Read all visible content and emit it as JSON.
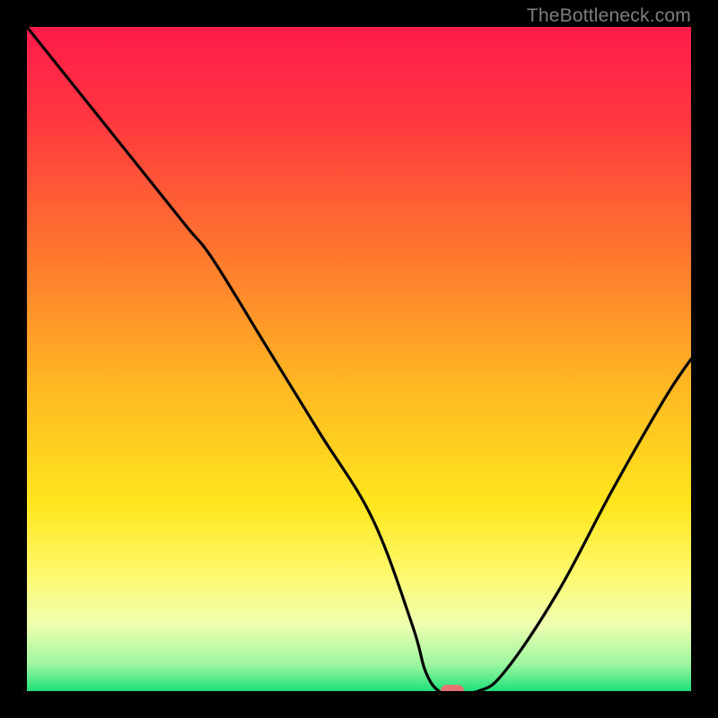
{
  "attribution": "TheBottleneck.com",
  "chart_data": {
    "type": "line",
    "title": "",
    "xlabel": "",
    "ylabel": "",
    "xlim": [
      0,
      100
    ],
    "ylim": [
      0,
      100
    ],
    "x": [
      0,
      8,
      16,
      24,
      28,
      36,
      44,
      52,
      58,
      60,
      62,
      64,
      68,
      72,
      80,
      88,
      96,
      100
    ],
    "y": [
      100,
      90,
      80,
      70,
      65,
      52,
      39,
      26,
      10,
      3,
      0,
      0,
      0,
      3,
      15,
      30,
      44,
      50
    ],
    "gradient": {
      "type": "vertical",
      "stops": [
        {
          "pos": 0.0,
          "color": "#ff1b4c"
        },
        {
          "pos": 0.15,
          "color": "#ff3a3e"
        },
        {
          "pos": 0.35,
          "color": "#ff7a2e"
        },
        {
          "pos": 0.55,
          "color": "#ffba22"
        },
        {
          "pos": 0.72,
          "color": "#ffe61e"
        },
        {
          "pos": 0.82,
          "color": "#fff86a"
        },
        {
          "pos": 0.9,
          "color": "#eeffb0"
        },
        {
          "pos": 0.96,
          "color": "#9cf7a0"
        },
        {
          "pos": 1.0,
          "color": "#1fe07a"
        }
      ]
    },
    "marker": {
      "x": 64,
      "y": 0,
      "color": "#e57373"
    }
  }
}
